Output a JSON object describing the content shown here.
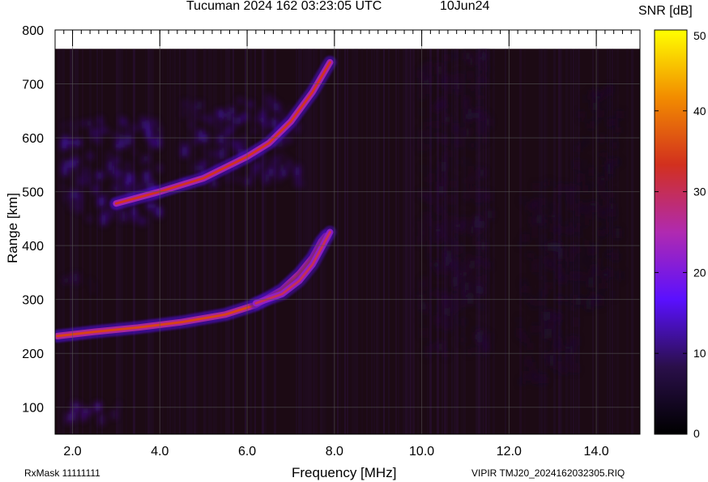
{
  "header": {
    "title": "Tucuman 2024 162 03:23:05 UTC",
    "date": "10Jun24"
  },
  "footer": {
    "rxmask": "RxMask 11111111",
    "file_id": "VIPIR  TMJ20_2024162032305.RIQ"
  },
  "colorbar": {
    "title": "SNR [dB]",
    "ticks": [
      "0",
      "10",
      "20",
      "30",
      "40",
      "50"
    ],
    "range": [
      0,
      50
    ],
    "colors": [
      "#000000",
      "#2a0f4a",
      "#5a10ff",
      "#b02ab0",
      "#d2301e",
      "#f28c00",
      "#ffff00"
    ]
  },
  "chart_data": {
    "type": "heatmap",
    "title": "Tucuman 2024 162 03:23:05 UTC",
    "xlabel": "Frequency [MHz]",
    "ylabel": "Range [km]",
    "xlim": [
      1.6,
      15.0
    ],
    "ylim": [
      50,
      800
    ],
    "data_ylim": [
      50,
      765
    ],
    "xticks": [
      "2.0",
      "4.0",
      "6.0",
      "8.0",
      "10.0",
      "12.0",
      "14.0"
    ],
    "yticks": [
      "100",
      "200",
      "300",
      "400",
      "500",
      "600",
      "700",
      "800"
    ],
    "grid": true,
    "background_color": "#1c0a14",
    "traces": [
      {
        "name": "",
        "snr": 35,
        "x": [
          1.65,
          2.5,
          3.5,
          4.5,
          5.5,
          6.2,
          6.8,
          7.2,
          7.5,
          7.7,
          7.8
        ],
        "y": [
          232,
          240,
          248,
          258,
          272,
          290,
          318,
          348,
          378,
          408,
          418
        ]
      },
      {
        "name": "",
        "snr": 30,
        "x": [
          6.2,
          6.8,
          7.2,
          7.5,
          7.7,
          7.9
        ],
        "y": [
          293,
          310,
          335,
          365,
          395,
          425
        ]
      },
      {
        "name": "",
        "snr": 33,
        "x": [
          3.0,
          4.0,
          5.0,
          5.5,
          6.0,
          6.5,
          7.0,
          7.5,
          7.9
        ],
        "y": [
          478,
          500,
          525,
          545,
          565,
          590,
          630,
          685,
          740
        ]
      }
    ],
    "diffuse_regions": [
      {
        "x": [
          1.7,
          4.0
        ],
        "y": [
          450,
          640
        ],
        "snr": 15
      },
      {
        "x": [
          4.5,
          7.2
        ],
        "y": [
          520,
          680
        ],
        "snr": 14
      },
      {
        "x": [
          1.7,
          3.5
        ],
        "y": [
          85,
          110
        ],
        "snr": 18
      },
      {
        "x": [
          1.7,
          2.5
        ],
        "y": [
          330,
          350
        ],
        "snr": 10
      },
      {
        "x": [
          9.9,
          11.5
        ],
        "y": [
          200,
          760
        ],
        "snr": 8
      },
      {
        "x": [
          12.2,
          13.5
        ],
        "y": [
          150,
          520
        ],
        "snr": 7
      },
      {
        "x": [
          13.5,
          14.5
        ],
        "y": [
          300,
          700
        ],
        "snr": 6
      }
    ]
  }
}
